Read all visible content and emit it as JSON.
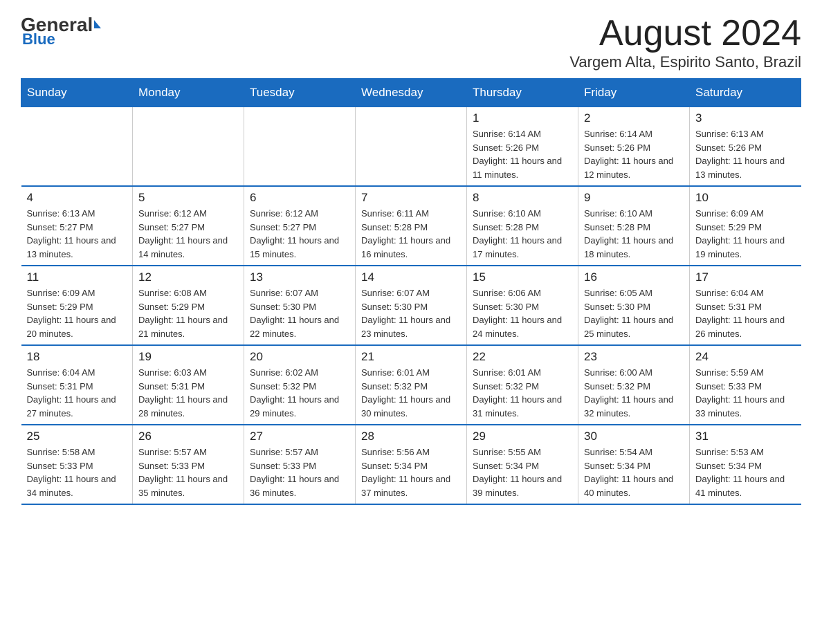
{
  "header": {
    "logo_general": "General",
    "logo_blue": "Blue",
    "month_title": "August 2024",
    "location": "Vargem Alta, Espirito Santo, Brazil"
  },
  "weekdays": [
    "Sunday",
    "Monday",
    "Tuesday",
    "Wednesday",
    "Thursday",
    "Friday",
    "Saturday"
  ],
  "weeks": [
    [
      {
        "day": "",
        "info": ""
      },
      {
        "day": "",
        "info": ""
      },
      {
        "day": "",
        "info": ""
      },
      {
        "day": "",
        "info": ""
      },
      {
        "day": "1",
        "info": "Sunrise: 6:14 AM\nSunset: 5:26 PM\nDaylight: 11 hours and 11 minutes."
      },
      {
        "day": "2",
        "info": "Sunrise: 6:14 AM\nSunset: 5:26 PM\nDaylight: 11 hours and 12 minutes."
      },
      {
        "day": "3",
        "info": "Sunrise: 6:13 AM\nSunset: 5:26 PM\nDaylight: 11 hours and 13 minutes."
      }
    ],
    [
      {
        "day": "4",
        "info": "Sunrise: 6:13 AM\nSunset: 5:27 PM\nDaylight: 11 hours and 13 minutes."
      },
      {
        "day": "5",
        "info": "Sunrise: 6:12 AM\nSunset: 5:27 PM\nDaylight: 11 hours and 14 minutes."
      },
      {
        "day": "6",
        "info": "Sunrise: 6:12 AM\nSunset: 5:27 PM\nDaylight: 11 hours and 15 minutes."
      },
      {
        "day": "7",
        "info": "Sunrise: 6:11 AM\nSunset: 5:28 PM\nDaylight: 11 hours and 16 minutes."
      },
      {
        "day": "8",
        "info": "Sunrise: 6:10 AM\nSunset: 5:28 PM\nDaylight: 11 hours and 17 minutes."
      },
      {
        "day": "9",
        "info": "Sunrise: 6:10 AM\nSunset: 5:28 PM\nDaylight: 11 hours and 18 minutes."
      },
      {
        "day": "10",
        "info": "Sunrise: 6:09 AM\nSunset: 5:29 PM\nDaylight: 11 hours and 19 minutes."
      }
    ],
    [
      {
        "day": "11",
        "info": "Sunrise: 6:09 AM\nSunset: 5:29 PM\nDaylight: 11 hours and 20 minutes."
      },
      {
        "day": "12",
        "info": "Sunrise: 6:08 AM\nSunset: 5:29 PM\nDaylight: 11 hours and 21 minutes."
      },
      {
        "day": "13",
        "info": "Sunrise: 6:07 AM\nSunset: 5:30 PM\nDaylight: 11 hours and 22 minutes."
      },
      {
        "day": "14",
        "info": "Sunrise: 6:07 AM\nSunset: 5:30 PM\nDaylight: 11 hours and 23 minutes."
      },
      {
        "day": "15",
        "info": "Sunrise: 6:06 AM\nSunset: 5:30 PM\nDaylight: 11 hours and 24 minutes."
      },
      {
        "day": "16",
        "info": "Sunrise: 6:05 AM\nSunset: 5:30 PM\nDaylight: 11 hours and 25 minutes."
      },
      {
        "day": "17",
        "info": "Sunrise: 6:04 AM\nSunset: 5:31 PM\nDaylight: 11 hours and 26 minutes."
      }
    ],
    [
      {
        "day": "18",
        "info": "Sunrise: 6:04 AM\nSunset: 5:31 PM\nDaylight: 11 hours and 27 minutes."
      },
      {
        "day": "19",
        "info": "Sunrise: 6:03 AM\nSunset: 5:31 PM\nDaylight: 11 hours and 28 minutes."
      },
      {
        "day": "20",
        "info": "Sunrise: 6:02 AM\nSunset: 5:32 PM\nDaylight: 11 hours and 29 minutes."
      },
      {
        "day": "21",
        "info": "Sunrise: 6:01 AM\nSunset: 5:32 PM\nDaylight: 11 hours and 30 minutes."
      },
      {
        "day": "22",
        "info": "Sunrise: 6:01 AM\nSunset: 5:32 PM\nDaylight: 11 hours and 31 minutes."
      },
      {
        "day": "23",
        "info": "Sunrise: 6:00 AM\nSunset: 5:32 PM\nDaylight: 11 hours and 32 minutes."
      },
      {
        "day": "24",
        "info": "Sunrise: 5:59 AM\nSunset: 5:33 PM\nDaylight: 11 hours and 33 minutes."
      }
    ],
    [
      {
        "day": "25",
        "info": "Sunrise: 5:58 AM\nSunset: 5:33 PM\nDaylight: 11 hours and 34 minutes."
      },
      {
        "day": "26",
        "info": "Sunrise: 5:57 AM\nSunset: 5:33 PM\nDaylight: 11 hours and 35 minutes."
      },
      {
        "day": "27",
        "info": "Sunrise: 5:57 AM\nSunset: 5:33 PM\nDaylight: 11 hours and 36 minutes."
      },
      {
        "day": "28",
        "info": "Sunrise: 5:56 AM\nSunset: 5:34 PM\nDaylight: 11 hours and 37 minutes."
      },
      {
        "day": "29",
        "info": "Sunrise: 5:55 AM\nSunset: 5:34 PM\nDaylight: 11 hours and 39 minutes."
      },
      {
        "day": "30",
        "info": "Sunrise: 5:54 AM\nSunset: 5:34 PM\nDaylight: 11 hours and 40 minutes."
      },
      {
        "day": "31",
        "info": "Sunrise: 5:53 AM\nSunset: 5:34 PM\nDaylight: 11 hours and 41 minutes."
      }
    ]
  ]
}
